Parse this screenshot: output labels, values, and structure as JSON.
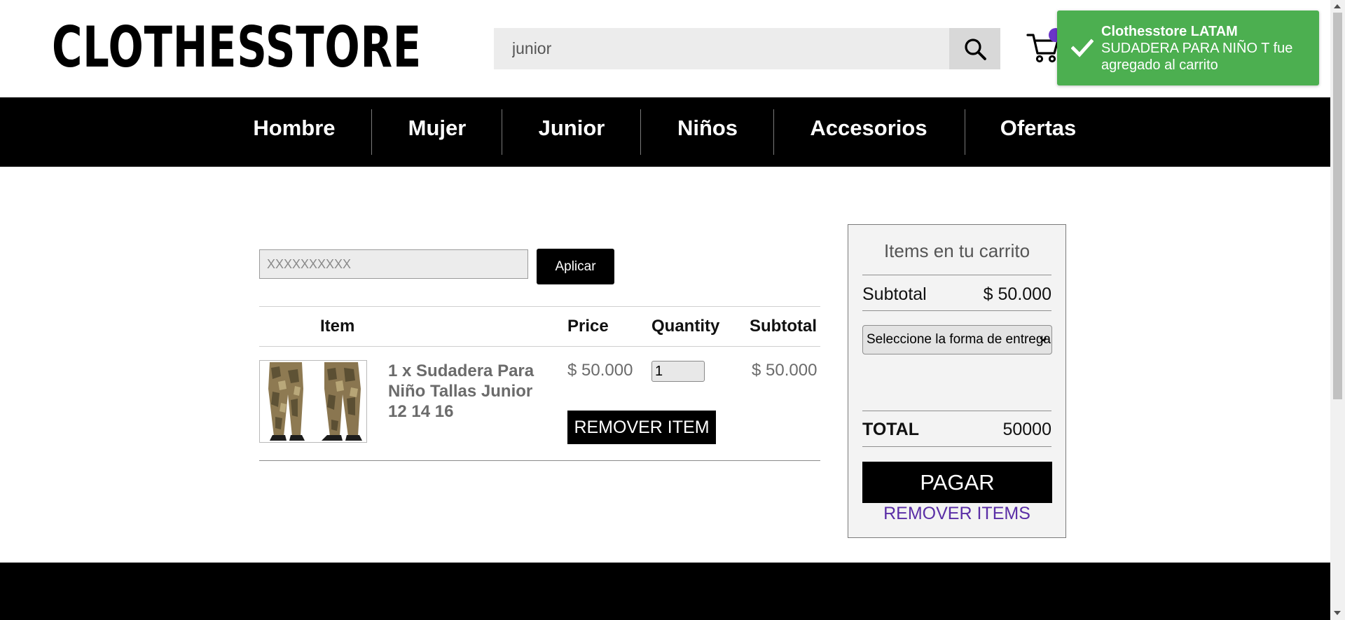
{
  "header": {
    "logo": "CLOTHESSTORE",
    "search": {
      "value": "junior"
    },
    "icons": {
      "search": "search-icon",
      "cart": "cart-icon"
    }
  },
  "nav": {
    "items": [
      {
        "label": "Hombre"
      },
      {
        "label": "Mujer"
      },
      {
        "label": "Junior"
      },
      {
        "label": "Niños"
      },
      {
        "label": "Accesorios"
      },
      {
        "label": "Ofertas"
      }
    ]
  },
  "coupon": {
    "placeholder": "XXXXXXXXXX",
    "apply_label": "Aplicar"
  },
  "cart_table": {
    "headers": {
      "item": "Item",
      "price": "Price",
      "quantity": "Quantity",
      "subtotal": "Subtotal"
    },
    "rows": [
      {
        "title": "1 x Sudadera Para Niño Tallas Junior 12 14 16",
        "price": "$ 50.000",
        "quantity": "1",
        "subtotal": "$ 50.000",
        "remove_label": "REMOVER ITEM"
      }
    ]
  },
  "summary": {
    "title": "Items en tu carrito",
    "subtotal_label": "Subtotal",
    "subtotal_value": "$ 50.000",
    "delivery_select": "Seleccione la forma de entrega",
    "total_label": "TOTAL",
    "total_value": "50000",
    "pay_label": "PAGAR",
    "remove_items_label": "REMOVER ITEMS"
  },
  "toast": {
    "title": "Clothesstore LATAM",
    "message": "SUDADERA PARA NIÑO T fue agregado al carrito"
  },
  "colors": {
    "brand_purple": "#6b35c9",
    "toast_green": "#4caf50",
    "link_purple": "#5a2ea6",
    "nav_bg": "#000000"
  }
}
